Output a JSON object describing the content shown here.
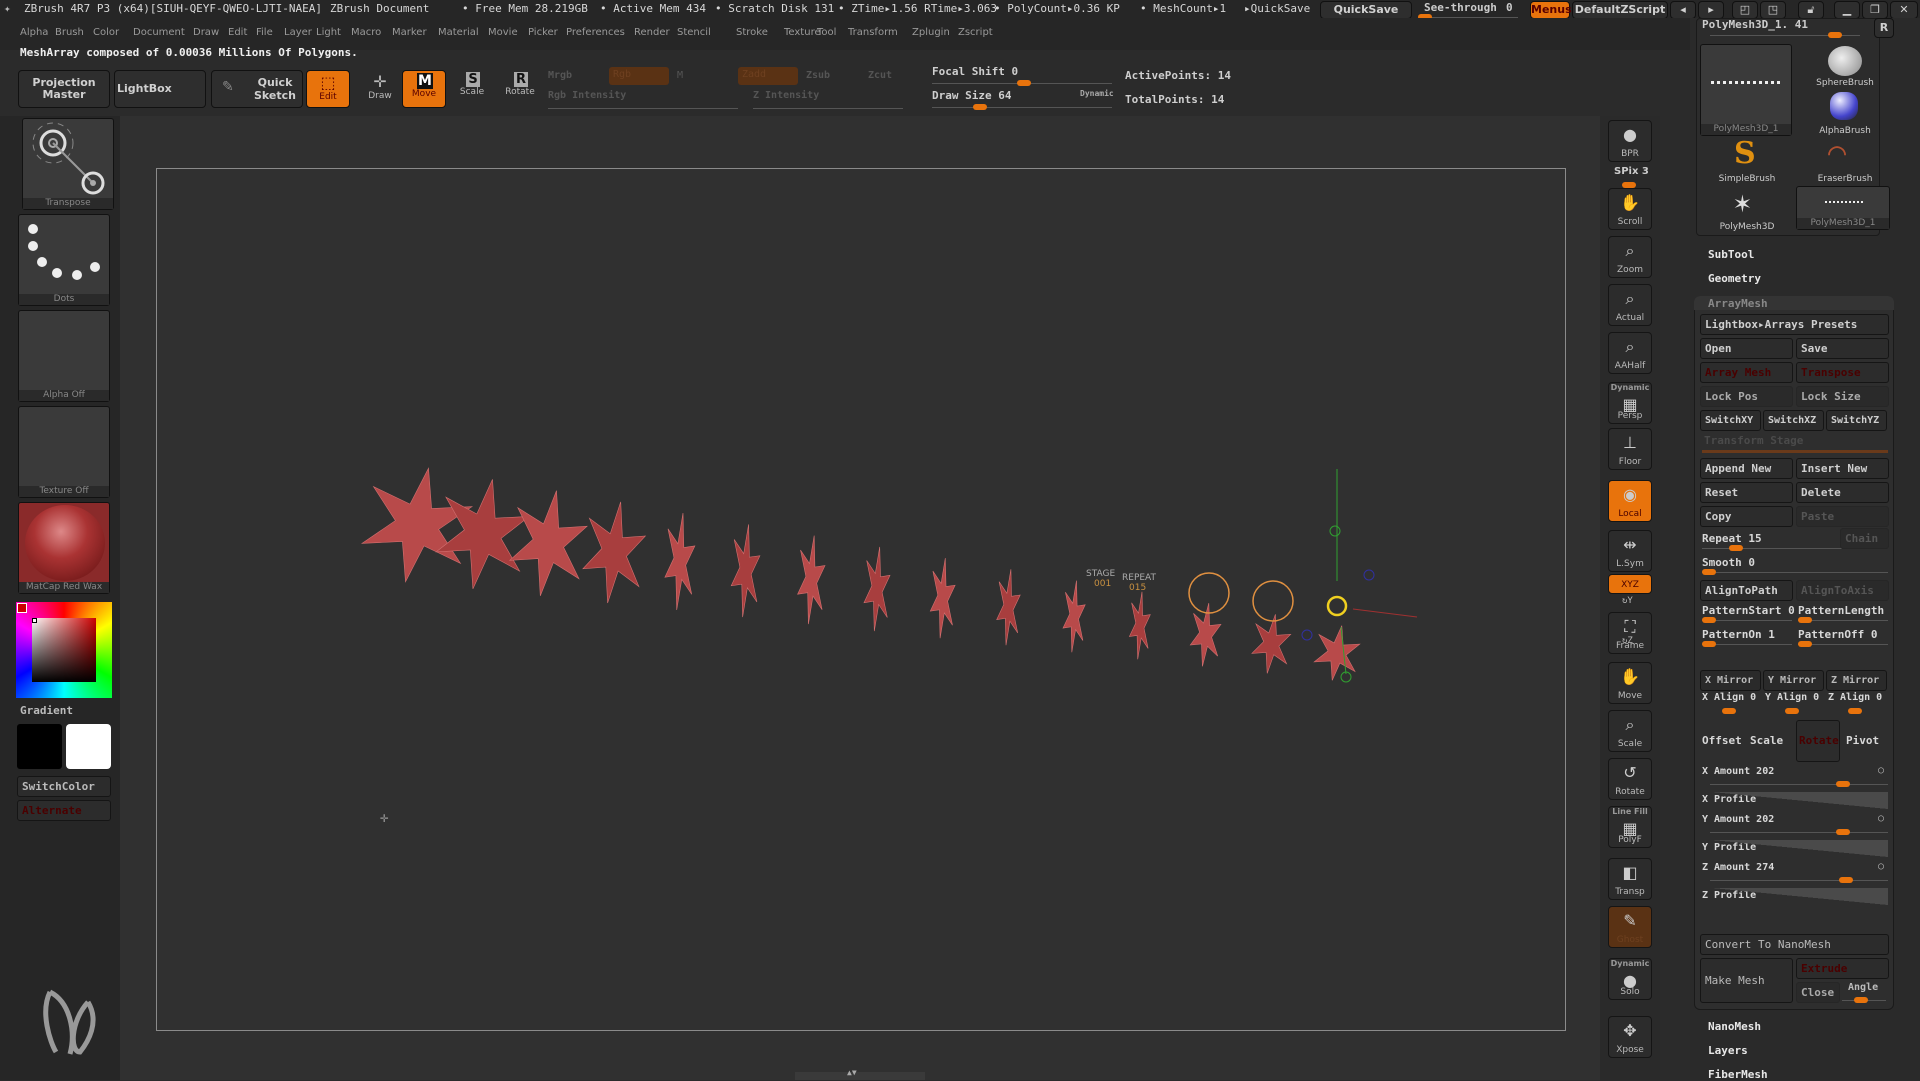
{
  "titlebar": {
    "app": "ZBrush 4R7 P3 (x64)[SIUH-QEYF-QWEO-LJTI-NAEA]",
    "document": "ZBrush Document",
    "free_mem": "• Free Mem 28.219GB",
    "active_mem": "• Active Mem 434",
    "scratch": "• Scratch Disk 131",
    "ztime": "• ZTime▸1.56 RTime▸3.063",
    "polycount": "• PolyCount▸0.36 KP",
    "meshcount": "• MeshCount▸1",
    "quicksave_label": "▸QuickSave",
    "quicksave_button": "QuickSave",
    "see_through": "See-through",
    "see_through_value": "0",
    "see_through_fraction": 0.0,
    "menus_button": "Menus",
    "script_button": "DefaultZScript"
  },
  "menus": [
    "Alpha",
    "Brush",
    "Color",
    "Document",
    "Draw",
    "Edit",
    "File",
    "Layer",
    "Light",
    "Macro",
    "Marker",
    "Material",
    "Movie",
    "Picker",
    "Preferences",
    "Render",
    "Stencil",
    "Stroke",
    "Texture",
    "Tool",
    "Transform",
    "Zplugin",
    "Zscript"
  ],
  "note": "MeshArray composed of 0.00036 Millions Of Polygons.",
  "toolbar": {
    "projection_master": "Projection Master",
    "lightbox": "LightBox",
    "quick_sketch": "Quick Sketch",
    "edit": "Edit",
    "draw": "Draw",
    "move": "Move",
    "scale": "Scale",
    "rotate": "Rotate",
    "mrgb": "Mrgb",
    "rgb": "Rgb",
    "m": "M",
    "rgb_intensity": "Rgb Intensity",
    "zadd": "Zadd",
    "zsub": "Zsub",
    "zcut": "Zcut",
    "z_intensity": "Z Intensity",
    "focal_shift": "Focal Shift 0",
    "draw_size": "Draw Size 64",
    "dynamic": "Dynamic",
    "active_points": "ActivePoints: 14",
    "total_points": "TotalPoints: 14"
  },
  "left": {
    "transpose": "Transpose",
    "dots": "Dots",
    "alpha_off": "Alpha Off",
    "texture_off": "Texture Off",
    "material": "MatCap Red Wax",
    "gradient": "Gradient",
    "switch_color": "SwitchColor",
    "alternate": "Alternate"
  },
  "canvas": {
    "stage_label": "STAGE",
    "stage_value": "001",
    "repeat_label": "REPEAT",
    "repeat_value": "015"
  },
  "right_tools": [
    {
      "label": "BPR",
      "icon": "bpr-sphere-icon"
    },
    {
      "label": "SPix 3"
    },
    {
      "label": "Scroll",
      "icon": "hand-icon"
    },
    {
      "label": "Zoom",
      "icon": "magnifier-icon"
    },
    {
      "label": "Actual",
      "icon": "magnifier-x1-icon"
    },
    {
      "label": "AAHalf",
      "icon": "magnifier-half-icon"
    },
    {
      "label": "Persp",
      "top": "Dynamic",
      "icon": "perspective-grid-icon"
    },
    {
      "label": "Floor",
      "icon": "floor-icon"
    },
    {
      "label": "Local",
      "icon": "local-icon"
    },
    {
      "label": "L.Sym",
      "icon": "symmetry-icon"
    },
    {
      "label": "XYZ",
      "icon": "rotate-xyz-icon"
    },
    {
      "label": "Frame",
      "icon": "frame-icon"
    },
    {
      "label": "Move",
      "icon": "move-hand-icon"
    },
    {
      "label": "Scale",
      "icon": "scale-icon"
    },
    {
      "label": "Rotate",
      "icon": "rotate-icon"
    },
    {
      "label": "PolyF",
      "top": "Line Fill",
      "icon": "polyframe-icon"
    },
    {
      "label": "Transp",
      "icon": "transparency-icon"
    },
    {
      "label": "Ghost",
      "icon": "ghost-icon"
    },
    {
      "label": "Solo",
      "top": "Dynamic",
      "icon": "solo-icon"
    },
    {
      "label": "Xpose",
      "icon": "xpose-icon"
    }
  ],
  "tool_panel": {
    "title": "PolyMesh3D_1. 41",
    "r_button": "R",
    "brushes": [
      "PolyMesh3D_1",
      "SphereBrush",
      "AlphaBrush",
      "SimpleBrush",
      "EraserBrush",
      "PolyMesh3D",
      "PolyMesh3D_1"
    ],
    "subtool": "SubTool",
    "geometry": "Geometry",
    "arraymesh": "ArrayMesh",
    "lightbox_presets": "Lightbox▸Arrays Presets",
    "open": "Open",
    "save": "Save",
    "array_mesh": "Array Mesh",
    "transpose": "Transpose",
    "lock_pos": "Lock Pos",
    "lock_size": "Lock Size",
    "switch_xy": "SwitchXY",
    "switch_xz": "SwitchXZ",
    "switch_yz": "SwitchYZ",
    "transform_stage": "Transform Stage",
    "append_new": "Append New",
    "insert_new": "Insert New",
    "reset": "Reset",
    "delete": "Delete",
    "copy": "Copy",
    "paste": "Paste",
    "repeat": "Repeat 15",
    "chain": "Chain",
    "smooth": "Smooth 0",
    "align_to_path": "AlignToPath",
    "align_to_axis": "AlignToAxis",
    "pattern_start": "PatternStart 0",
    "pattern_length": "PatternLength",
    "pattern_on": "PatternOn 1",
    "pattern_off": "PatternOff 0",
    "x_mirror": "X Mirror",
    "y_mirror": "Y Mirror",
    "z_mirror": "Z Mirror",
    "x_align": "X Align 0",
    "y_align": "Y Align 0",
    "z_align": "Z Align 0",
    "offset": "Offset",
    "scale": "Scale",
    "rotate": "Rotate",
    "pivot": "Pivot",
    "x_amount": "X Amount 202",
    "x_profile": "X Profile",
    "y_amount": "Y Amount 202",
    "y_profile": "Y Profile",
    "z_amount": "Z Amount 274",
    "z_profile": "Z Profile",
    "convert_nanomesh": "Convert To NanoMesh",
    "make_mesh": "Make Mesh",
    "extrude": "Extrude",
    "close": "Close",
    "angle": "Angle",
    "nanomesh": "NanoMesh",
    "layers": "Layers",
    "fibermesh": "FiberMesh"
  },
  "colors": {
    "accent": "#e8730c",
    "star": "#b84a4a",
    "bg": "#303030"
  }
}
